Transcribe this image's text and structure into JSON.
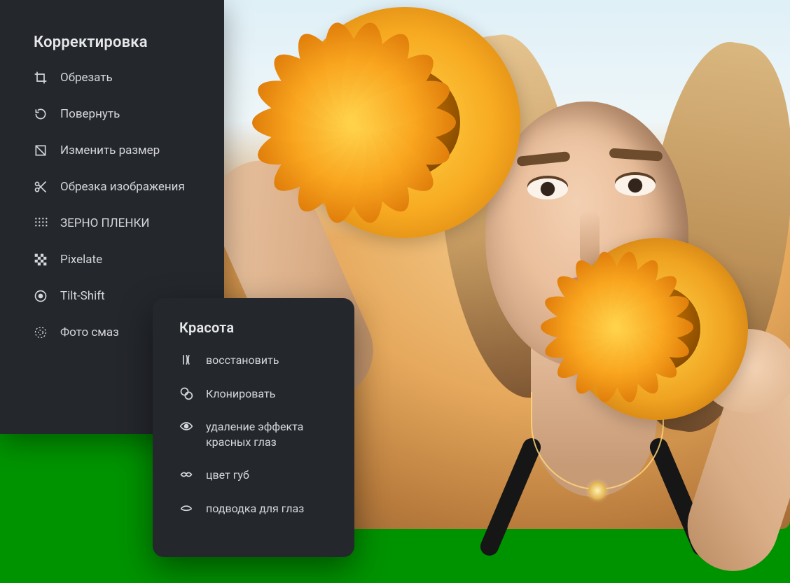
{
  "adjust_panel": {
    "title": "Корректировка",
    "items": [
      {
        "icon": "crop-icon",
        "label": "Обрезать"
      },
      {
        "icon": "rotate-icon",
        "label": "Повернуть"
      },
      {
        "icon": "resize-icon",
        "label": "Изменить размер"
      },
      {
        "icon": "cut-icon",
        "label": "Обрезка изображения"
      },
      {
        "icon": "grain-icon",
        "label": "ЗЕРНО ПЛЕНКИ"
      },
      {
        "icon": "pixelate-icon",
        "label": "Pixelate"
      },
      {
        "icon": "tilt-shift-icon",
        "label": "Tilt-Shift"
      },
      {
        "icon": "photo-blur-icon",
        "label": "Фото смаз"
      }
    ]
  },
  "beauty_panel": {
    "title": "Красота",
    "items": [
      {
        "icon": "heal-icon",
        "label": "восстановить"
      },
      {
        "icon": "clone-icon",
        "label": "Клонировать"
      },
      {
        "icon": "red-eye-icon",
        "label": "удаление эффекта красных глаз"
      },
      {
        "icon": "lip-color-icon",
        "label": "цвет губ"
      },
      {
        "icon": "eyeliner-icon",
        "label": "подводка для глаз"
      }
    ]
  },
  "colors": {
    "panel_bg": "#24272c",
    "text": "#d5d7da",
    "footer_bg": "#009300"
  }
}
